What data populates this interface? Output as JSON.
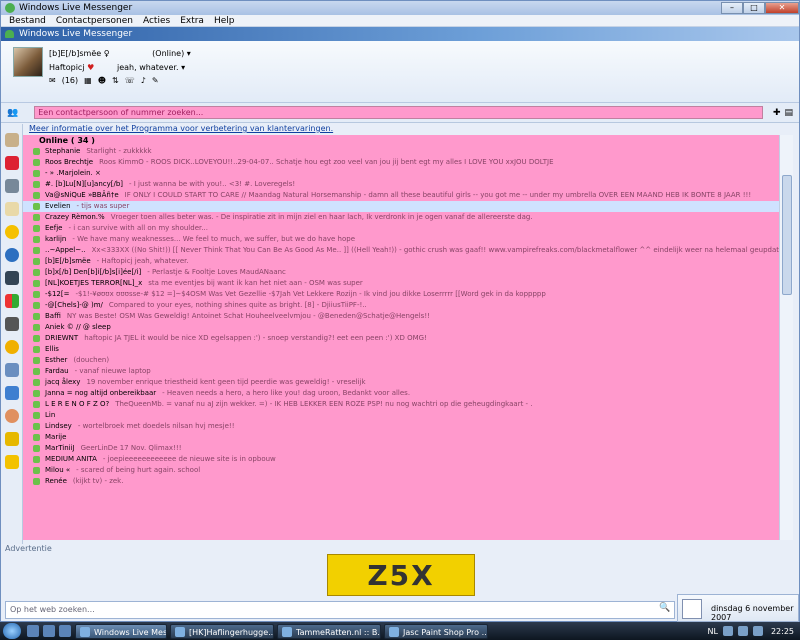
{
  "window": {
    "title": "Windows Live Messenger"
  },
  "menu": [
    "Bestand",
    "Contactpersonen",
    "Acties",
    "Extra",
    "Help"
  ],
  "app_header": "Windows Live Messenger",
  "profile": {
    "name": "[b]E[/b]smëe ♀",
    "status": "(Online)",
    "personal_message": "Haftopicj",
    "sub_status": "jeah, whatever.",
    "mail_count": "(16)"
  },
  "search": {
    "placeholder": "Een contactpersoon of nummer zoeken..."
  },
  "info_link": "Meer informatie over het Programma voor verbetering van klantervaringen.",
  "group": "Online ( 34 )",
  "contacts": [
    {
      "name": "Stephanie",
      "msg": "Starlight - zukkkkk"
    },
    {
      "name": "Roos Brechtje",
      "msg": "Roos KimmO - ROOS DICK..LOVEYOU!!..29-04-07.. Schatje hou egt zoo veel van jou jij bent egt my alles I LOVE YOU xxJOU DOLTJE"
    },
    {
      "name": "- » .Marjolein. × ",
      "msg": ""
    },
    {
      "name": "#. [b]Lu[N][u]ancy[/b]",
      "msg": "- I just wanna be with you!.. <3!      #. Loveregels!"
    },
    {
      "name": "Va@sNiQuE  »BBÂñ†e",
      "msg": "IF ONLY I COULD START TO CARE // Maandag Natural Horsemanship - damn all these beautiful girls -- you got me -- under my umbrella  OVER EEN MAAND HEB IK BONTE 8 JAAR !!!"
    },
    {
      "name": "Evelien",
      "msg": "- tijs was super",
      "hl": true
    },
    {
      "name": "Crazey Rèmon.%",
      "msg": "Vroeger toen alles beter was. - De inspiratie zit in mijn ziel en haar lach, Ik verdronk in je ogen vanaf de allereerste dag."
    },
    {
      "name": "Eefje",
      "msg": "- i can survive with all  on my shoulder..."
    },
    {
      "name": "karlijn",
      "msg": "- We have many weaknesses... We feel to much, we suffer, but we do have hope"
    },
    {
      "name": "..~Appel~..",
      "msg": "Xx<333XX    ((No Shit!)) [[ Never Think That You Can Be As Good As Me.. ]] ((Hell Yeah!)) - gothic crush was gaaf!!    www.vampirefreaks.com/blackmetalflower    ^^ eindelijk weer na helemaal geupdate"
    },
    {
      "name": "[b]E[/b]smëe",
      "msg": "- Haftopicj    jeah, whatever."
    },
    {
      "name": "[b]x[/b] Den[b]i[/b]s[i]ée[/i]",
      "msg": "- Perlastje & Fooltje    Loves MaudANaanc"
    },
    {
      "name": "[NL]KOETJES TERROR[NL]_x",
      "msg": "sta me eventjes bij want ik kan het niet aan - OSM was super"
    },
    {
      "name": "-$12[=",
      "msg": "-$1!-¥øʊʊx ʊʊʊsse-# $12  =]~$4OSM Was Vet Gezellie    -$7Jah Vet Lekkere Rozijn - Ik vind jou dikke Loserrrrr [[Word gek in da koppppp"
    },
    {
      "name": "-@[Chels]-@ )m/",
      "msg": "Compared to your eyes, nothing shines quite as bright. [8] - DjiiusTiiPF-!.."
    },
    {
      "name": "Baffi",
      "msg": "NY was Beste! OSM Was Geweldig!    Antoinet Schat Houheelveelvmjou - @Beneden@Schatje@Hengels!!"
    },
    {
      "name": "Aniek © // @ sleep",
      "msg": ""
    },
    {
      "name": "DRIEWNT",
      "msg": "haftopic    JA TJEL it would be nice XD    egelsappen :') - snoep verstandig?! eet een peen :')  XD   OMG!"
    },
    {
      "name": "Ellis",
      "msg": ""
    },
    {
      "name": "Esther",
      "msg": "(douchen)"
    },
    {
      "name": "Fardau",
      "msg": "- vanaf nieuwe laptop"
    },
    {
      "name": "jacq ålexy",
      "msg": "19 november enrique  triestheid kent geen tijd  peerdie was geweldig! - vreselijk"
    },
    {
      "name": "Janna = nog altijd onbereikbaar",
      "msg": "- Heaven needs a hero, a hero like you! dag uroon, Bedankt voor alles."
    },
    {
      "name": "L E R E N O F Z O?",
      "msg": "TheQueenMb. = vanaf nu aJ zijn wekker.    =) - IK HEB LEKKER EEN ROZE PSP!     nu nog wachtri op die geheugdingkaart - ."
    },
    {
      "name": "Lin",
      "msg": ""
    },
    {
      "name": "Lindsey",
      "msg": "- wortelbroek met doedels nilsan    hvj mesje!!"
    },
    {
      "name": "Marije",
      "msg": ""
    },
    {
      "name": "MarTiniiJ",
      "msg": "GeerLinDe 17 Nov. Qlimax!!!"
    },
    {
      "name": "MEDIUM ANITA",
      "msg": "- joepieeeeeeeeeeee de nieuwe site is in opbouw"
    },
    {
      "name": "Milou «",
      "msg": "- scared of being hurt again.      school"
    },
    {
      "name": "Renée",
      "msg": "(kijkt tv) - zek."
    }
  ],
  "ad_label": "Advertentie",
  "ad_text": "Z5X",
  "web_search": {
    "placeholder": "Op het web zoeken..."
  },
  "date": "dinsdag 6 november 2007",
  "taskbar": {
    "tasks": [
      "Windows Live Messen...",
      "[HK]Haflingerhugge...",
      "TammeRatten.nl :: B...",
      "Jasc Paint Shop Pro ..."
    ],
    "language": "NL",
    "clock": "22:25"
  },
  "colors": {
    "contact_list_bg": "#ff99cc",
    "header_blue": "#2d5fa6"
  }
}
